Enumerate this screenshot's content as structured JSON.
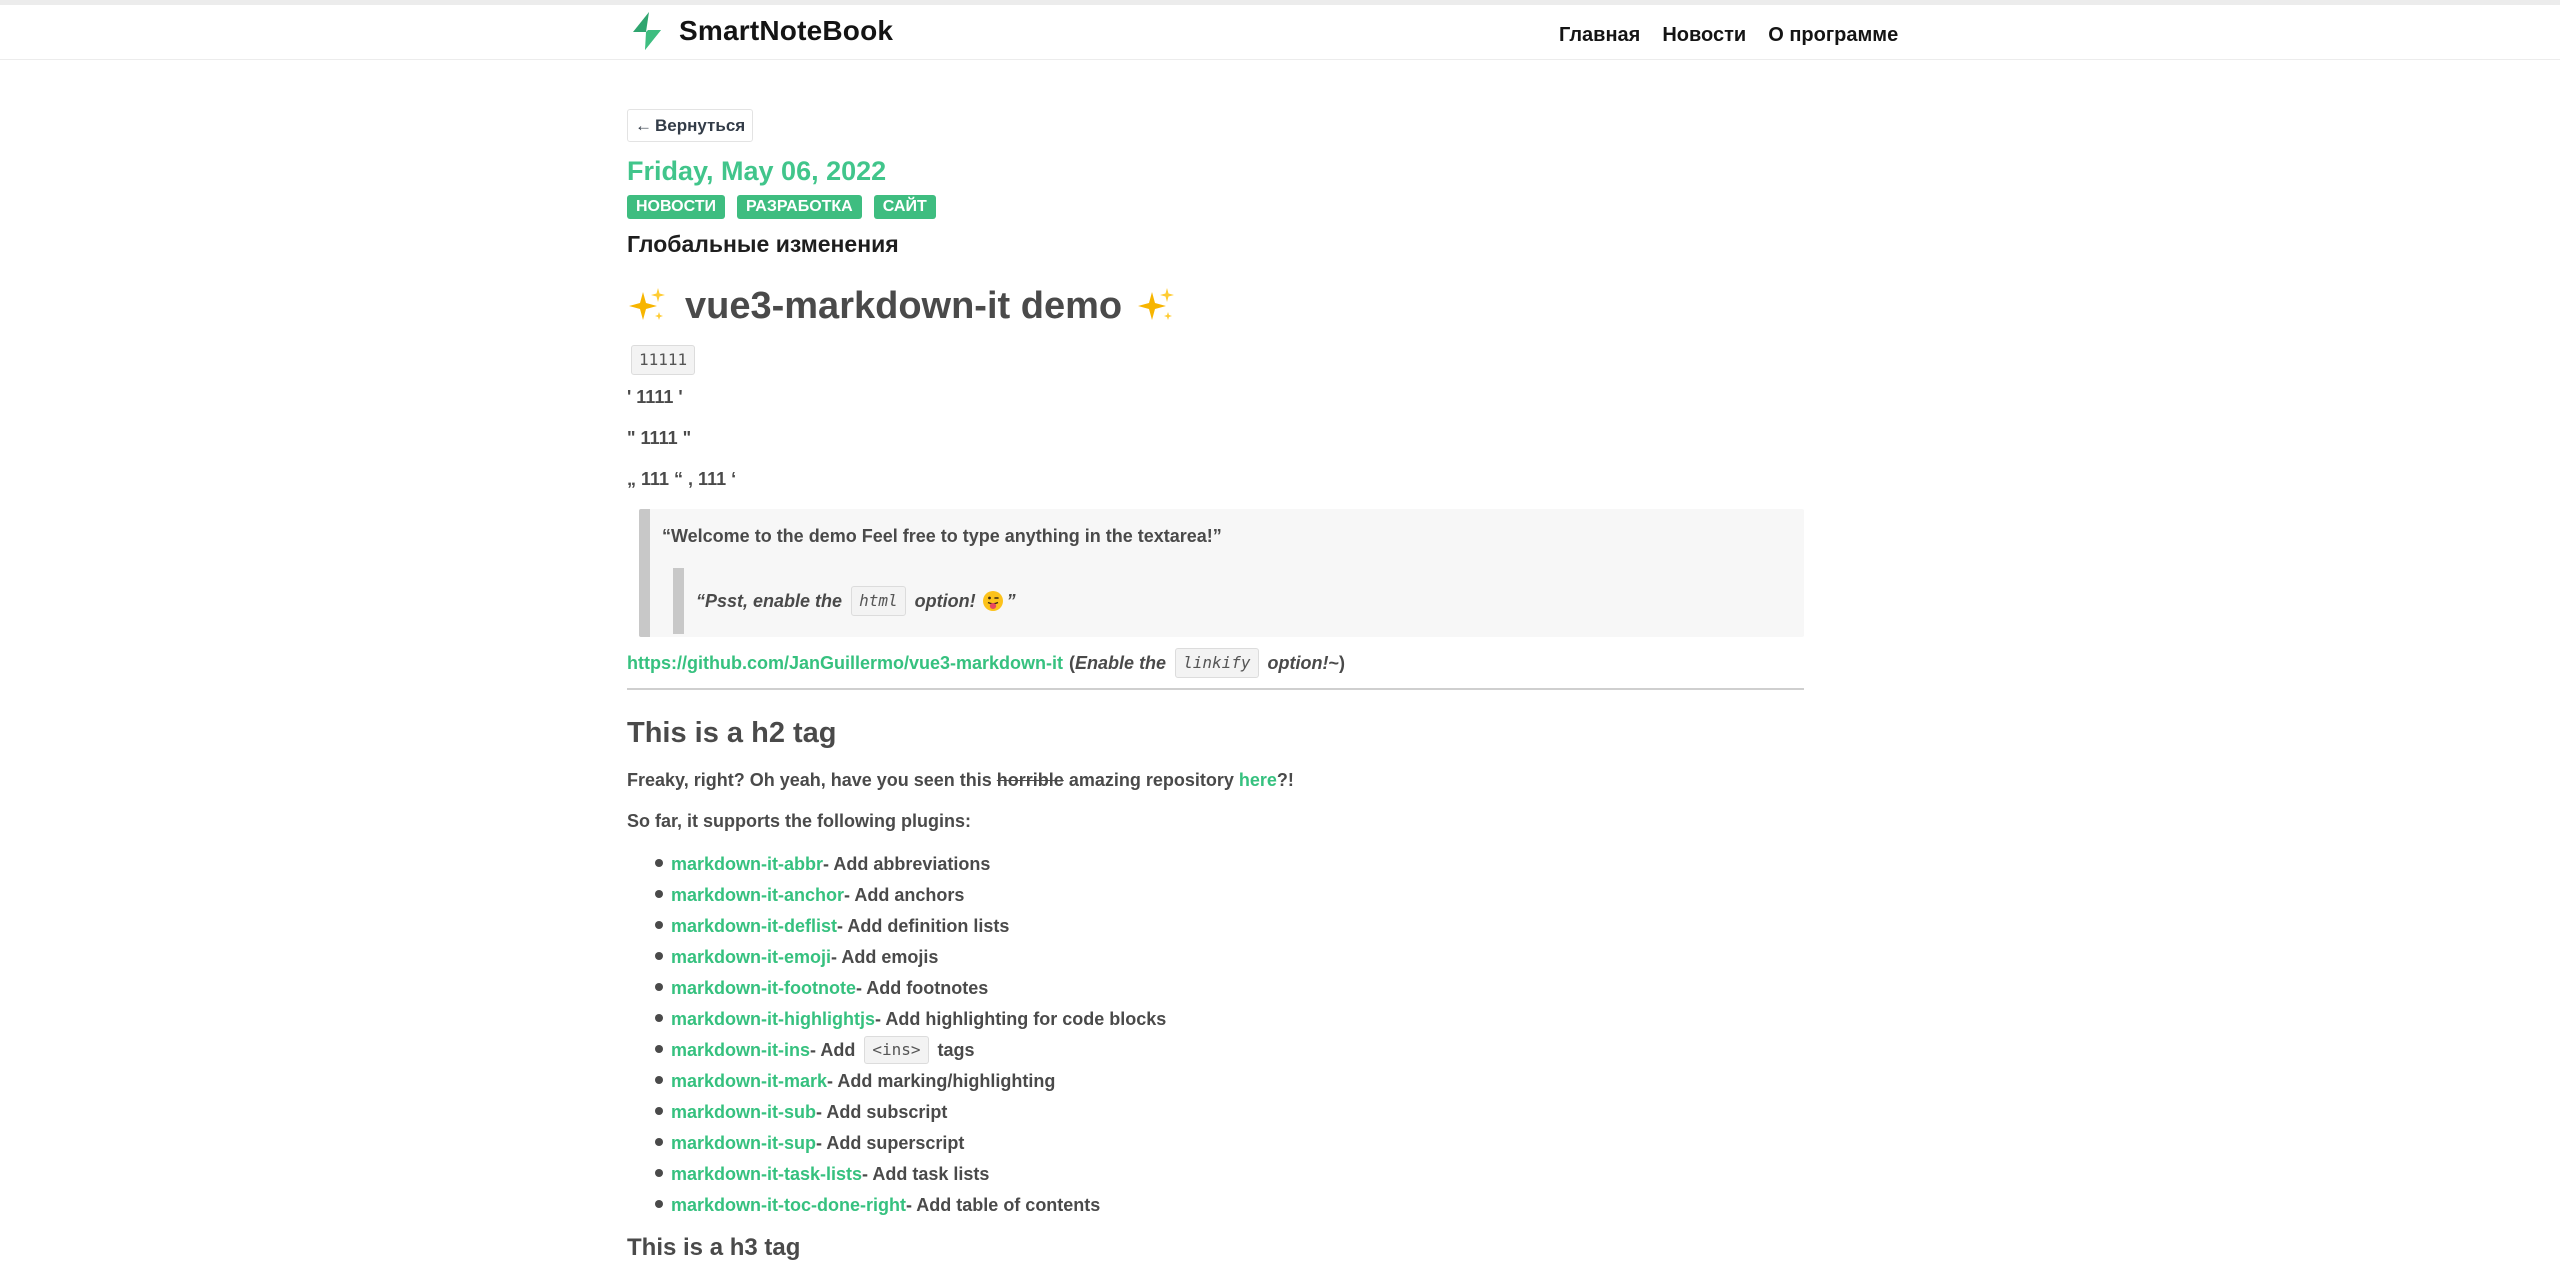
{
  "colors": {
    "accent": "#3ebd80",
    "link": "#36c17f",
    "text": "#4a4a4a",
    "heading": "#141414"
  },
  "header": {
    "brand": "SmartNoteBook",
    "brand_icon": "bolt-logo-icon",
    "nav": [
      {
        "label": "Главная"
      },
      {
        "label": "Новости"
      },
      {
        "label": "О программе"
      }
    ]
  },
  "post": {
    "back_label": "Вернуться",
    "back_icon": "arrow-left-icon",
    "date": "Friday, May 06, 2022",
    "tags": [
      "НОВОСТИ",
      "РАЗРАБОТКА",
      "САЙТ"
    ],
    "title": "Глобальные изменения"
  },
  "markdown": {
    "h1": "vue3-markdown-it demo",
    "sparkle_icon": "sparkles-icon",
    "code": "11111",
    "quotes": [
      "' 1111 '",
      "\" 1111 \"",
      "„ 111 “ , 111 ‘"
    ],
    "blockquote": "“Welcome to the demo Feel free to type anything in the textarea!”",
    "nested_quote": {
      "open": "“",
      "before": "Psst, enable the",
      "code": "html",
      "after": "option!",
      "emoji": "tongue-out-face-icon",
      "close": "”"
    },
    "repo_link": "https://github.com/JanGuillermo/vue3-markdown-it",
    "linkify_note": {
      "open": "(",
      "before": "Enable the",
      "code": "linkify",
      "after": "option!",
      "tail": "~)"
    },
    "h2": "This is a h2 tag",
    "freaky": {
      "before": "Freaky, right? Oh yeah, have you seen this ",
      "strike": "horrible",
      "middle": " amazing repository ",
      "link": "here",
      "after": "?!"
    },
    "supports": "So far, it supports the following plugins:",
    "plugins": [
      {
        "name": "markdown-it-abbr",
        "desc": " - Add abbreviations"
      },
      {
        "name": "markdown-it-anchor",
        "desc": " - Add anchors"
      },
      {
        "name": "markdown-it-deflist",
        "desc": " - Add definition lists"
      },
      {
        "name": "markdown-it-emoji",
        "desc": " - Add emojis"
      },
      {
        "name": "markdown-it-footnote",
        "desc": " - Add footnotes"
      },
      {
        "name": "markdown-it-highlightjs",
        "desc": " - Add highlighting for code blocks"
      },
      {
        "name": "markdown-it-ins",
        "desc": " - Add",
        "code": "<ins>",
        "tail": "tags"
      },
      {
        "name": "markdown-it-mark",
        "desc": " - Add marking/highlighting"
      },
      {
        "name": "markdown-it-sub",
        "desc": " - Add subscript"
      },
      {
        "name": "markdown-it-sup",
        "desc": " - Add superscript"
      },
      {
        "name": "markdown-it-task-lists",
        "desc": " - Add task lists"
      },
      {
        "name": "markdown-it-toc-done-right",
        "desc": " - Add table of contents"
      }
    ],
    "h3": "This is a h3 tag"
  }
}
